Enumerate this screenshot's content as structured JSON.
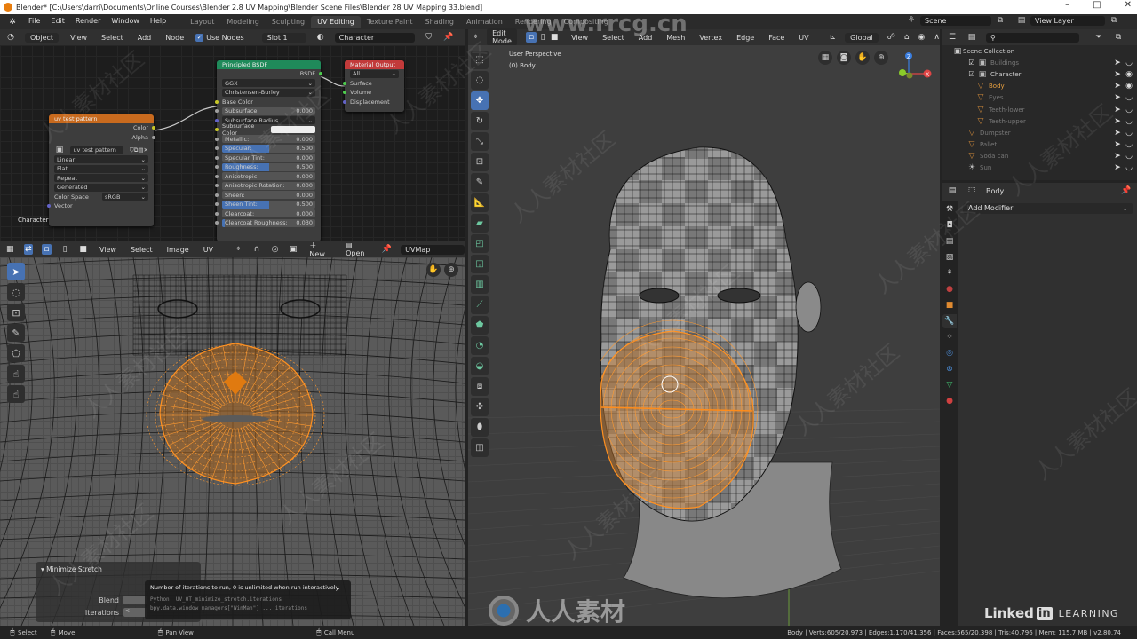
{
  "window": {
    "title": "Blender* [C:\\Users\\darri\\Documents\\Online Courses\\Blender 2.8 UV Mapping\\Blender Scene Files\\Blender 28 UV Mapping 33.blend]",
    "controls": {
      "minimize": "–",
      "maximize": "□",
      "close": "✕"
    }
  },
  "menu": [
    "File",
    "Edit",
    "Render",
    "Window",
    "Help"
  ],
  "workspaces": [
    {
      "label": "Layout",
      "active": false
    },
    {
      "label": "Modeling",
      "active": false
    },
    {
      "label": "Sculpting",
      "active": false
    },
    {
      "label": "UV Editing",
      "active": true
    },
    {
      "label": "Texture Paint",
      "active": false
    },
    {
      "label": "Shading",
      "active": false
    },
    {
      "label": "Animation",
      "active": false
    },
    {
      "label": "Rendering",
      "active": false
    },
    {
      "label": "Compositing",
      "active": false
    }
  ],
  "scene": {
    "scene_name": "Scene",
    "view_layer": "View Layer"
  },
  "node_editor": {
    "header": {
      "mode": "Object",
      "menus": [
        "View",
        "Select",
        "Add",
        "Node"
      ],
      "use_nodes_label": "Use Nodes",
      "use_nodes_checked": true,
      "slot": "Slot 1",
      "material": "Character"
    },
    "material_label": "Character",
    "image_node": {
      "title": "uv test pattern",
      "outputs": [
        "Color",
        "Alpha"
      ],
      "image_name": "uv test pattern",
      "interpolation": "Linear",
      "projection": "Flat",
      "extension": "Repeat",
      "source": "Generated",
      "color_space_label": "Color Space",
      "color_space": "sRGB",
      "input": "Vector"
    },
    "bsdf_node": {
      "title": "Principled BSDF",
      "output": "BSDF",
      "distribution": "GGX",
      "subsurface_method": "Christensen-Burley",
      "base_color_label": "Base Color",
      "params": [
        {
          "label": "Subsurface:",
          "value": "0.000",
          "fill": 0
        },
        {
          "label": "Subsurface Radius",
          "value": "",
          "fill": -1
        },
        {
          "label": "Subsurface Color",
          "value": "",
          "fill": -2
        },
        {
          "label": "Metallic:",
          "value": "0.000",
          "fill": 0
        },
        {
          "label": "Specular:",
          "value": "0.500",
          "fill": 0.5
        },
        {
          "label": "Specular Tint:",
          "value": "0.000",
          "fill": 0
        },
        {
          "label": "Roughness:",
          "value": "0.500",
          "fill": 0.5
        },
        {
          "label": "Anisotropic:",
          "value": "0.000",
          "fill": 0
        },
        {
          "label": "Anisotropic Rotation:",
          "value": "0.000",
          "fill": 0
        },
        {
          "label": "Sheen:",
          "value": "0.000",
          "fill": 0
        },
        {
          "label": "Sheen Tint:",
          "value": "0.500",
          "fill": 0.5
        },
        {
          "label": "Clearcoat:",
          "value": "0.000",
          "fill": 0
        },
        {
          "label": "Clearcoat Roughness:",
          "value": "0.030",
          "fill": 0.03
        }
      ]
    },
    "output_node": {
      "title": "Material Output",
      "target": "All",
      "inputs": [
        "Surface",
        "Volume",
        "Displacement"
      ]
    }
  },
  "uv_editor": {
    "header": {
      "menus": [
        "View",
        "Select",
        "Image",
        "UV"
      ],
      "new_label": "New",
      "open_label": "Open",
      "uvmap": "UVMap"
    },
    "tools": [
      "select-box",
      "cursor",
      "transform",
      "annotate",
      "grab",
      "relax",
      "pinch"
    ],
    "operator_panel": {
      "title": "Minimize Stretch",
      "fields": [
        {
          "label": "Blend",
          "value": ""
        },
        {
          "label": "Iterations",
          "value": "<"
        }
      ]
    },
    "tooltip": {
      "description": "Number of iterations to run, 0 is unlimited when run interactively.",
      "python1": "Python: UV_OT_minimize_stretch.iterations",
      "python2": "bpy.data.window_managers[\"WinMan\"] ... iterations"
    }
  },
  "viewport": {
    "header": {
      "mode": "Edit Mode",
      "menus": [
        "View",
        "Select",
        "Add",
        "Mesh",
        "Vertex",
        "Edge",
        "Face",
        "UV"
      ],
      "orientation": "Global"
    },
    "overlay_text": {
      "perspective": "User Perspective",
      "object": "(0) Body"
    },
    "gizmo": {
      "x": "X",
      "y": "Y",
      "z": "Z"
    },
    "tools": [
      "select-box",
      "cursor",
      "move",
      "rotate",
      "scale",
      "transform",
      "annotate",
      "measure",
      "extrude",
      "inset",
      "bevel",
      "loop-cut",
      "knife",
      "poly-build",
      "spin",
      "smooth",
      "edge-slide",
      "shrink-fatten",
      "shear",
      "rip"
    ]
  },
  "outliner": {
    "root": "Scene Collection",
    "items": [
      {
        "label": "Buildings",
        "depth": 1,
        "type": "collection",
        "dim": true,
        "checked": true
      },
      {
        "label": "Character",
        "depth": 1,
        "type": "collection",
        "dim": false,
        "checked": true
      },
      {
        "label": "Body",
        "depth": 2,
        "type": "mesh",
        "dim": false,
        "active": true
      },
      {
        "label": "Eyes",
        "depth": 2,
        "type": "mesh",
        "dim": true
      },
      {
        "label": "Teeth-lower",
        "depth": 2,
        "type": "mesh",
        "dim": true
      },
      {
        "label": "Teeth-upper",
        "depth": 2,
        "type": "mesh",
        "dim": true
      },
      {
        "label": "Dumpster",
        "depth": 1,
        "type": "mesh",
        "dim": true
      },
      {
        "label": "Pallet",
        "depth": 1,
        "type": "mesh",
        "dim": true
      },
      {
        "label": "Soda can",
        "depth": 1,
        "type": "mesh",
        "dim": true
      },
      {
        "label": "Sun",
        "depth": 1,
        "type": "light",
        "dim": true
      }
    ]
  },
  "properties": {
    "object": "Body",
    "add_modifier": "Add Modifier",
    "tabs": [
      "tool",
      "render",
      "output",
      "view-layer",
      "scene",
      "world",
      "object",
      "modifiers",
      "particles",
      "physics",
      "constraints",
      "data",
      "material"
    ],
    "active_tab": "modifiers"
  },
  "statusbar": {
    "select": "Select",
    "move": "Move",
    "pan": "Pan View",
    "call_menu": "Call Menu",
    "stats": "Body | Verts:605/20,973 | Edges:1,170/41,356 | Faces:565/20,398 | Tris:40,796 | Mem: 115.7 MB | v2.80.74"
  },
  "watermarks": {
    "site": "www.rrcg.cn",
    "brand": "人人素材",
    "community": "人人素材社区"
  },
  "branding": {
    "linkedin_text": "Linked",
    "linkedin_in": "in",
    "learning": "LEARNING"
  },
  "colors": {
    "accent": "#4772b3",
    "selection": "#ff8c1a",
    "bsdf_header": "#1f8a5a",
    "image_header": "#c86a1e",
    "output_header": "#c23a3a"
  }
}
